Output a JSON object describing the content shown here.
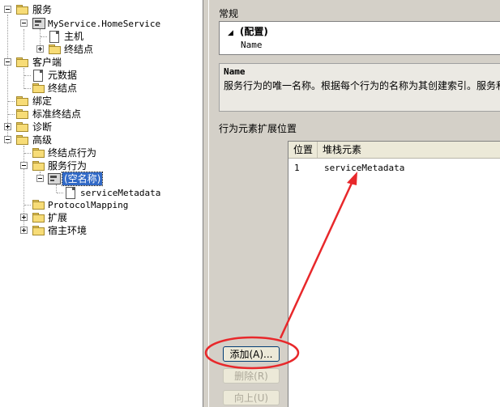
{
  "tree": {
    "items": [
      {
        "label": "服务"
      },
      {
        "label": "MyService.HomeService"
      },
      {
        "label": "主机"
      },
      {
        "label": "终结点"
      },
      {
        "label": "客户端"
      },
      {
        "label": "元数据"
      },
      {
        "label": "终结点"
      },
      {
        "label": "绑定"
      },
      {
        "label": "标准终结点"
      },
      {
        "label": "诊断"
      },
      {
        "label": "高级"
      },
      {
        "label": "终结点行为"
      },
      {
        "label": "服务行为"
      },
      {
        "label": "(空名称)"
      },
      {
        "label": "serviceMetadata"
      },
      {
        "label": "ProtocolMapping"
      },
      {
        "label": "扩展"
      },
      {
        "label": "宿主环境"
      }
    ]
  },
  "general": {
    "title": "常规",
    "category": "(配置)",
    "property_name": "Name"
  },
  "description": {
    "title": "Name",
    "text": "服务行为的唯一名称。根据每个行为的名称为其创建索引。服务和"
  },
  "extensions": {
    "title": "行为元素扩展位置",
    "columns": [
      "位置",
      "堆栈元素"
    ],
    "rows": [
      {
        "position": "1",
        "element": "serviceMetadata"
      }
    ]
  },
  "buttons": {
    "add": "添加(A)...",
    "remove": "删除(R)",
    "up": "向上(U)"
  },
  "colors": {
    "annotation": "#e8282b",
    "selection": "#3169c6",
    "panel_bg": "#d4d0c8"
  }
}
